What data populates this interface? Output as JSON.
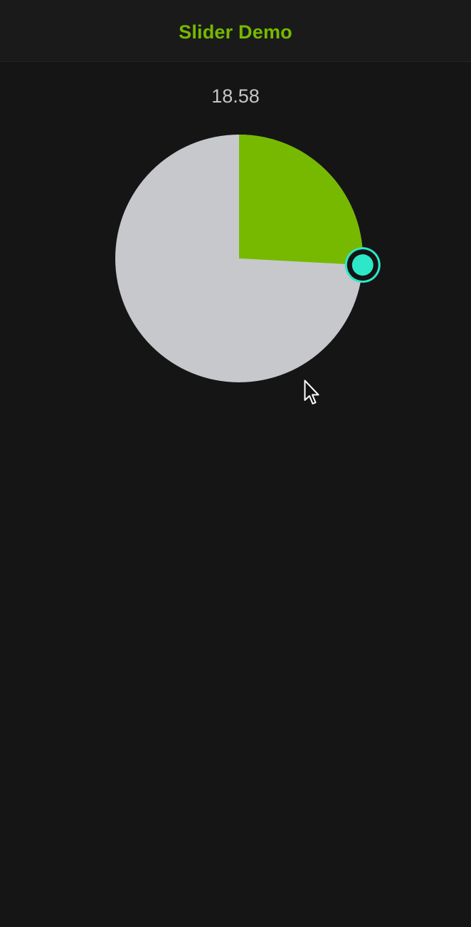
{
  "header": {
    "title": "Slider Demo"
  },
  "slider": {
    "value_text": "18.58",
    "fraction_filled": 0.2584,
    "colors": {
      "track": "#c7c8cc",
      "fill": "#76b900",
      "thumb": "#2de8c8",
      "thumb_ring": "#2de8c8",
      "thumb_inner_border": "#141414"
    }
  },
  "theme": {
    "background": "#151515",
    "accent": "#76b900",
    "value_text_color": "#c6c6c6"
  },
  "pointer": {
    "icon": "arrow-cursor-icon"
  }
}
